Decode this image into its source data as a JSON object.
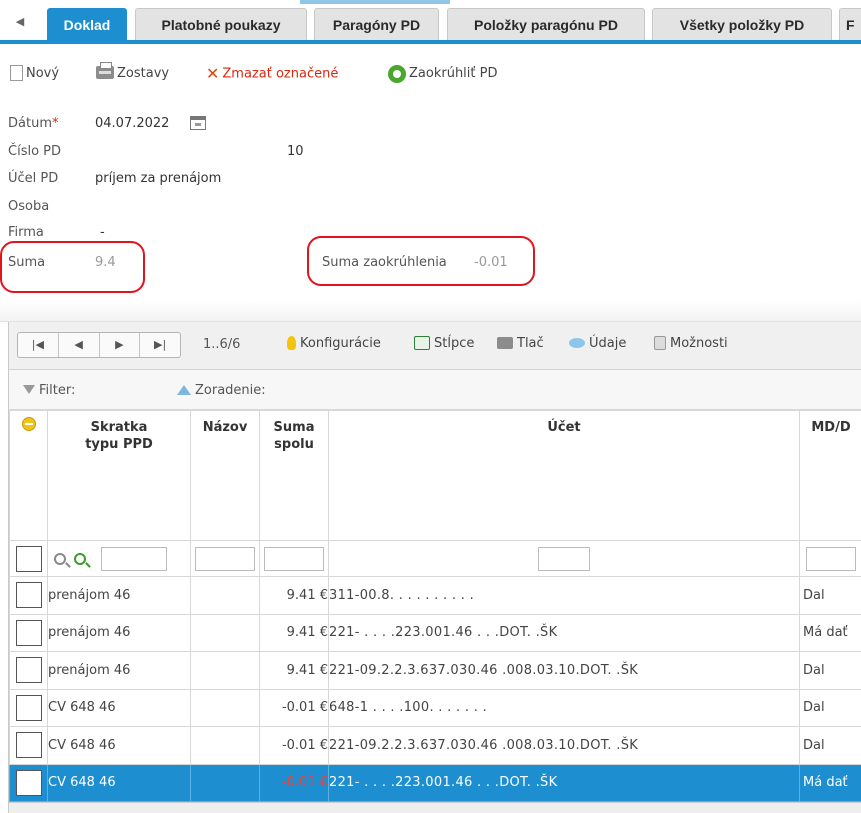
{
  "tabs": [
    {
      "label": "Doklad",
      "active": true
    },
    {
      "label": "Platobné poukazy"
    },
    {
      "label": "Paragóny PD"
    },
    {
      "label": "Položky paragónu PD"
    },
    {
      "label": "Všetky položky PD"
    },
    {
      "label": "F"
    }
  ],
  "toolbar": {
    "new_label": "Nový",
    "reports_label": "Zostavy",
    "delete_label": "Zmazať označené",
    "round_label": "Zaokrúhliť PD"
  },
  "form": {
    "date_label": "Dátum",
    "date_required": "*",
    "date_value": "04.07.2022",
    "number_label": "Číslo PD",
    "number_value": "10",
    "purpose_label": "Účel PD",
    "purpose_value": "príjem za prenájom",
    "person_label": "Osoba",
    "company_label": "Firma",
    "company_value": "-",
    "sum_label": "Suma",
    "sum_value": "9.4",
    "rounding_label": "Suma zaokrúhlenia",
    "rounding_value": "-0.01"
  },
  "grid": {
    "pager": {
      "first": "|◀",
      "prev": "◀",
      "next": "▶",
      "last": "▶|",
      "count": "1..6/6"
    },
    "tools": {
      "config": "Konfigurácie",
      "columns": "Stĺpce",
      "print": "Tlač",
      "data": "Údaje",
      "options": "Možnosti"
    },
    "filter_label": "Filter:",
    "sort_label": "Zoradenie:",
    "columns": {
      "type": "Skratka typu PPD",
      "name": "Názov",
      "sum": "Suma spolu",
      "account": "Účet",
      "mdd": "MD/D"
    },
    "rows": [
      {
        "type": "prenájom 46",
        "name": "",
        "sum": "9.41 €",
        "account": "311-00.8.  .  .   .   .    .    .   .   . .",
        "mdd": "Dal",
        "negative": false,
        "selected": false
      },
      {
        "type": "prenájom 46",
        "name": "",
        "sum": "9.41 €",
        "account": "221-  .  .  . .223.001.46  .   .   .DOT. .ŠK",
        "mdd": "Má dať",
        "negative": false,
        "selected": false
      },
      {
        "type": "prenájom 46",
        "name": "",
        "sum": "9.41 €",
        "account": "221-09.2.2.3.637.030.46  .008.03.10.DOT. .ŠK",
        "mdd": "Dal",
        "negative": false,
        "selected": false
      },
      {
        "type": "CV 648 46",
        "name": "",
        "sum": "-0.01 €",
        "account": "648-1  .  .  . .100.   .   .   .   .   .   .",
        "mdd": "Dal",
        "negative": true,
        "selected": false
      },
      {
        "type": "CV 648 46",
        "name": "",
        "sum": "-0.01 €",
        "account": "221-09.2.2.3.637.030.46  .008.03.10.DOT. .ŠK",
        "mdd": "Dal",
        "negative": true,
        "selected": false
      },
      {
        "type": "CV 648 46",
        "name": "",
        "sum": "-0.01 €",
        "account": "221-  .  .  . .223.001.46  .   .  .DOT. .ŠK",
        "mdd": "Má dať",
        "negative": true,
        "selected": true
      }
    ]
  },
  "colors": {
    "accent": "#1d8fd0",
    "annotation": "#e0141b",
    "negative": "#d8260f"
  }
}
